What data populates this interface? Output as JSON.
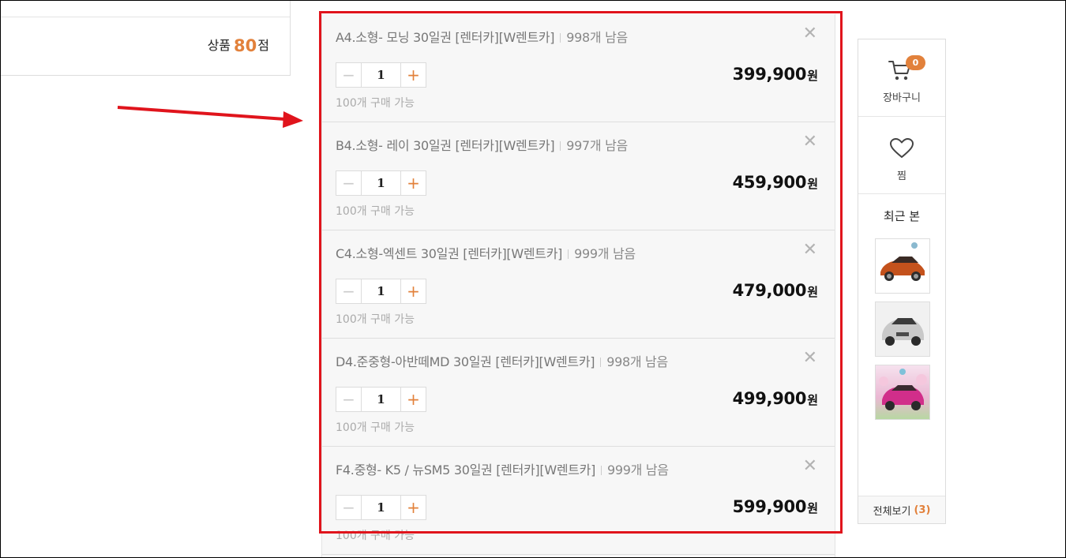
{
  "summary": {
    "label": "상품",
    "count": "80",
    "unit": "점"
  },
  "options": [
    {
      "title": "A4.소형- 모닝 30일권 [렌터카][W렌트카]",
      "stock": "998개 남음",
      "qty": "1",
      "limit": "100개 구매 가능",
      "price": "399,900",
      "currency": "원"
    },
    {
      "title": "B4.소형- 레이 30일권 [렌터카][W렌트카]",
      "stock": "997개 남음",
      "qty": "1",
      "limit": "100개 구매 가능",
      "price": "459,900",
      "currency": "원"
    },
    {
      "title": "C4.소형-엑센트 30일권 [렌터카][W렌트카]",
      "stock": "999개 남음",
      "qty": "1",
      "limit": "100개 구매 가능",
      "price": "479,000",
      "currency": "원"
    },
    {
      "title": "D4.준중형-아반떼MD 30일권 [렌터카][W렌트카]",
      "stock": "998개 남음",
      "qty": "1",
      "limit": "100개 구매 가능",
      "price": "499,900",
      "currency": "원"
    },
    {
      "title": "F4.중형- K5 / 뉴SM5 30일권 [렌터카][W렌트카]",
      "stock": "999개 남음",
      "qty": "1",
      "limit": "100개 구매 가능",
      "price": "599,900",
      "currency": "원"
    }
  ],
  "icons": {
    "close": "close-icon",
    "minus": "minus-icon",
    "plus": "plus-icon",
    "cart": "cart-icon",
    "heart": "heart-icon",
    "arrow": "arrow-icon"
  },
  "sidebar": {
    "cart_label": "장바구니",
    "cart_count": "0",
    "wish_label": "찜",
    "recent_title": "최근 본",
    "view_all_label": "전체보기",
    "view_all_count": "(3)"
  },
  "colors": {
    "accent": "#e2813b",
    "highlight_box": "#e0141c"
  }
}
